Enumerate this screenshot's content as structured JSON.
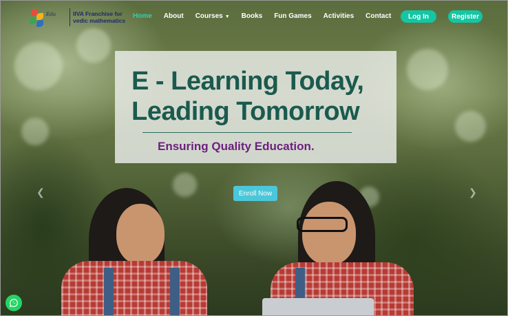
{
  "brand": {
    "logo_text": "IIVA Franchise for vedic mathematics",
    "logo_icon": "edu-arcs-flower-logo"
  },
  "nav": {
    "items": [
      {
        "label": "Home",
        "active": true
      },
      {
        "label": "About"
      },
      {
        "label": "Courses",
        "has_dropdown": true
      },
      {
        "label": "Books"
      },
      {
        "label": "Fun Games"
      },
      {
        "label": "Activities"
      },
      {
        "label": "Contact"
      }
    ],
    "login_label": "Log In",
    "register_label": "Register"
  },
  "hero": {
    "headline_line1": "E - Learning Today,",
    "headline_line2": "Leading Tomorrow",
    "tagline": "Ensuring Quality Education.",
    "cta_label": "Enroll Now",
    "prev_icon": "chevron-left-icon",
    "next_icon": "chevron-right-icon"
  },
  "floating": {
    "whatsapp_icon": "whatsapp-icon"
  },
  "colors": {
    "accent": "#13c6a4",
    "nav_active": "#2fd1b0",
    "headline": "#1b5a4e",
    "tagline": "#6b1f7e",
    "cta": "#4cc6d9"
  }
}
